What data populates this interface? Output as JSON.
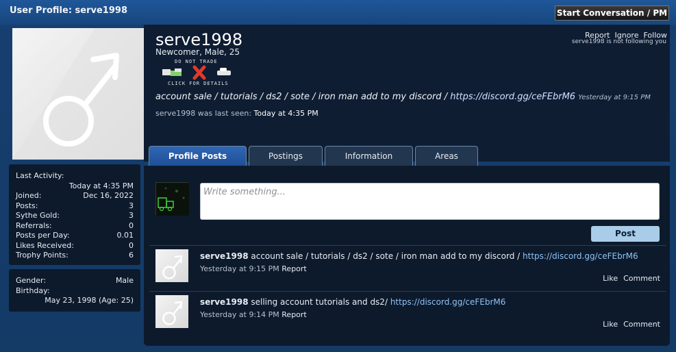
{
  "page": {
    "title": "User Profile: serve1998",
    "start_button": "Start Conversation / PM"
  },
  "profile": {
    "username": "serve1998",
    "title": "Newcomer, Male, 25",
    "trade_top": "DO NOT TRADE",
    "trade_bottom": "CLICK FOR DETAILS",
    "status_text": "account sale / tutorials / ds2 / sote / iron man add to my discord / ",
    "status_link": "https://discord.gg/ceFEbrM6",
    "status_time": "Yesterday at 9:15 PM",
    "last_seen_label": "serve1998 was last seen:",
    "last_seen_value": "Today at 4:35 PM",
    "actions": [
      "Report",
      "Ignore",
      "Follow"
    ],
    "follow_status": "serve1998 is not following you"
  },
  "stats": {
    "last_activity_label": "Last Activity:",
    "last_activity_value": "Today at 4:35 PM",
    "rows": [
      {
        "label": "Joined:",
        "value": "Dec 16, 2022"
      },
      {
        "label": "Posts:",
        "value": "3"
      },
      {
        "label": "Sythe Gold:",
        "value": "3"
      },
      {
        "label": "Referrals:",
        "value": "0"
      },
      {
        "label": "Posts per Day:",
        "value": "0.01"
      },
      {
        "label": "Likes Received:",
        "value": "0"
      },
      {
        "label": "Trophy Points:",
        "value": "6"
      }
    ]
  },
  "info": {
    "gender_label": "Gender:",
    "gender_value": "Male",
    "birthday_label": "Birthday:",
    "birthday_value": "May 23, 1998 (Age: 25)"
  },
  "tabs": [
    "Profile Posts",
    "Postings",
    "Information",
    "Areas"
  ],
  "composer": {
    "placeholder": "Write something...",
    "post_label": "Post"
  },
  "posts": [
    {
      "author": "serve1998",
      "text": " account sale / tutorials / ds2 / sote / iron man add to my discord / ",
      "link": "https://discord.gg/ceFEbrM6",
      "time": "Yesterday at 9:15 PM",
      "report": "Report",
      "like": "Like",
      "comment": "Comment"
    },
    {
      "author": "serve1998",
      "text": " selling account tutorials and ds2/ ",
      "link": "https://discord.gg/ceFEbrM6",
      "time": "Yesterday at 9:14 PM",
      "report": "Report",
      "like": "Like",
      "comment": "Comment"
    }
  ],
  "colors": {
    "accent": "#1f4f96",
    "panel": "#0d1a2c",
    "link": "#8fc3f5"
  }
}
